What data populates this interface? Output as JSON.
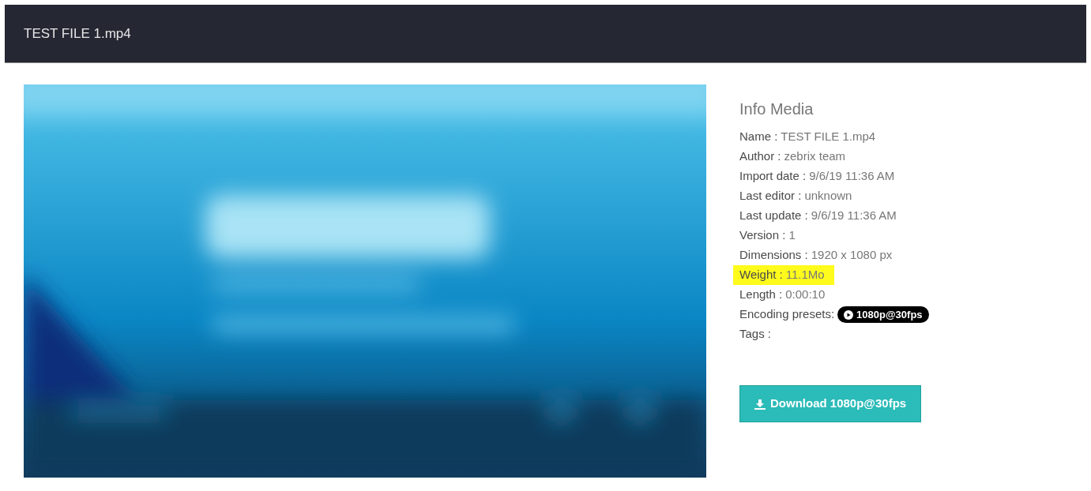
{
  "header": {
    "title": "TEST FILE 1.mp4"
  },
  "info": {
    "title": "Info Media",
    "rows": [
      {
        "kind": "text",
        "label": "Name :",
        "value": "TEST FILE 1.mp4",
        "highlighted": false
      },
      {
        "kind": "text",
        "label": "Author :",
        "value": "zebrix team",
        "highlighted": false
      },
      {
        "kind": "text",
        "label": "Import date :",
        "value": "9/6/19 11:36 AM",
        "highlighted": false
      },
      {
        "kind": "text",
        "label": "Last editor :",
        "value": "unknown",
        "highlighted": false
      },
      {
        "kind": "text",
        "label": "Last update :",
        "value": "9/6/19 11:36 AM",
        "highlighted": false
      },
      {
        "kind": "text",
        "label": "Version :",
        "value": "1",
        "highlighted": false
      },
      {
        "kind": "text",
        "label": "Dimensions :",
        "value": "1920 x 1080 px",
        "highlighted": false
      },
      {
        "kind": "text",
        "label": "Weight :",
        "value": "11.1Mo",
        "highlighted": true
      },
      {
        "kind": "text",
        "label": "Length :",
        "value": "0:00:10",
        "highlighted": false
      },
      {
        "kind": "badge",
        "label": "Encoding presets:",
        "value": "1080p@30fps",
        "highlighted": false
      },
      {
        "kind": "text",
        "label": "Tags :",
        "highlighted": false
      }
    ]
  },
  "download_button": {
    "label": "Download 1080p@30fps"
  }
}
